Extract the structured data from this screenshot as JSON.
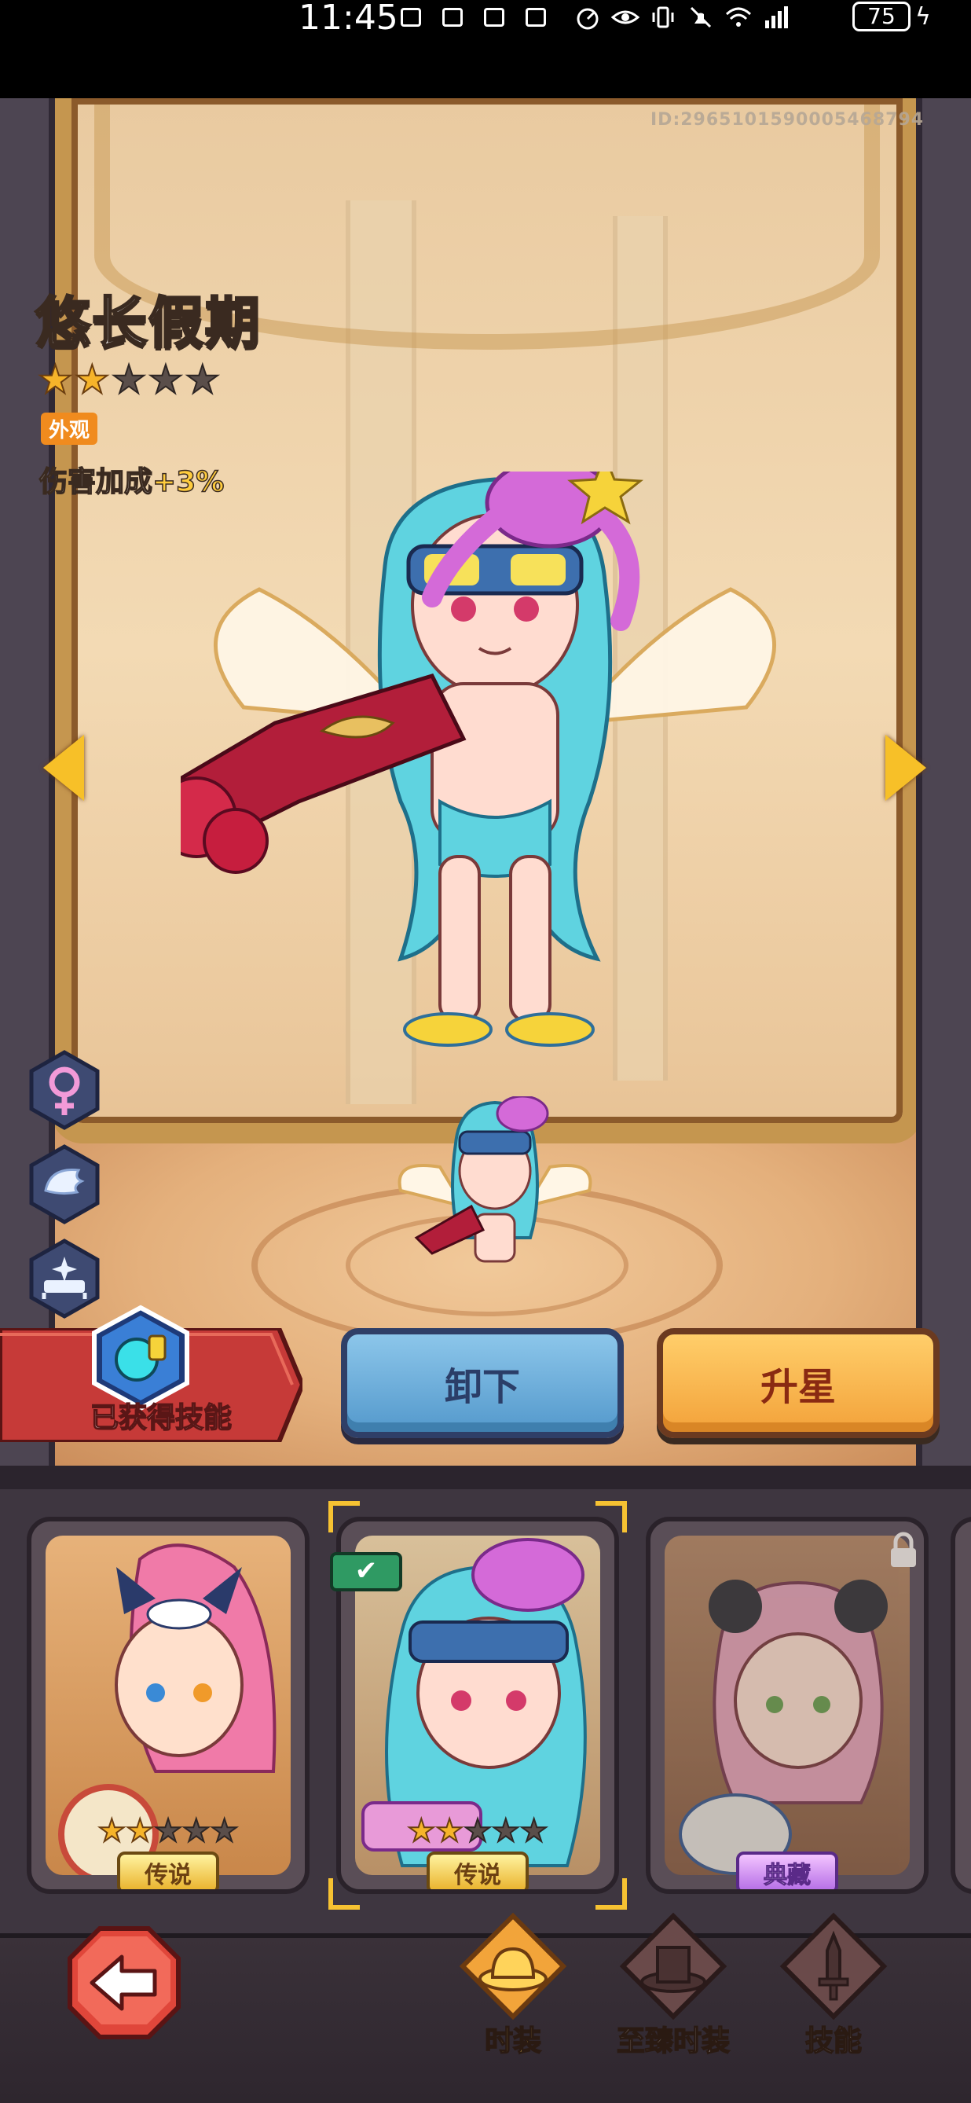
{
  "status_bar": {
    "time": "11:45",
    "battery": "75",
    "icons": [
      "notification-icon",
      "notification-icon",
      "notification-icon",
      "notification-icon",
      "data-saver-icon",
      "eye-icon",
      "vibrate-icon",
      "mute-icon",
      "wifi-icon",
      "signal-4g-icon",
      "charging-icon"
    ]
  },
  "scene": {
    "player_id": "ID:2965101590005468794",
    "costume_name": "悠长假期",
    "stars_total": 5,
    "stars_filled": 2,
    "type_tag": "外观",
    "bonus_label": "伤害加成",
    "bonus_value": "+3%"
  },
  "actions": {
    "skill_banner_label": "已获得技能",
    "unequip_label": "卸下",
    "star_up_label": "升星"
  },
  "cards": [
    {
      "name": "pink-sailor-costume",
      "stars_filled": 2,
      "stars_total": 5,
      "rarity": "传说",
      "selected": false,
      "locked": false
    },
    {
      "name": "long-vacation-costume",
      "stars_filled": 2,
      "stars_total": 5,
      "rarity": "传说",
      "selected": true,
      "locked": false
    },
    {
      "name": "panda-tea-costume",
      "stars_filled": 0,
      "stars_total": 0,
      "rarity": "典藏",
      "selected": false,
      "locked": true
    }
  ],
  "nav": {
    "tabs": [
      {
        "label": "时装",
        "active": true
      },
      {
        "label": "至臻时装",
        "active": false
      },
      {
        "label": "技能",
        "active": false
      }
    ]
  },
  "colors": {
    "accent_gold": "#f6b42a",
    "button_blue": "#5499cc",
    "button_orange": "#f3a23a",
    "banner_red": "#c63a38"
  }
}
